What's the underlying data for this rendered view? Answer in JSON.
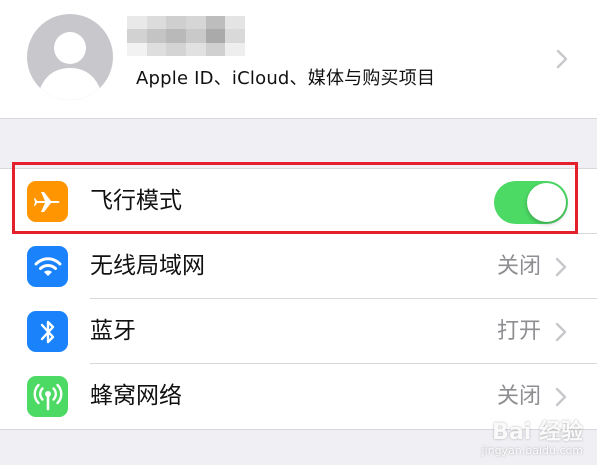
{
  "profile": {
    "subtitle": "Apple ID、iCloud、媒体与购买项目",
    "avatar_icon": "person-silhouette-icon",
    "chevron_icon": "chevron-right-icon"
  },
  "settings": {
    "airplane": {
      "label": "飞行模式",
      "icon": "airplane-icon",
      "color": "#ff9500",
      "toggle_on": true
    },
    "wifi": {
      "label": "无线局域网",
      "value": "关闭",
      "icon": "wifi-icon",
      "color": "#1a82fb"
    },
    "bluetooth": {
      "label": "蓝牙",
      "value": "打开",
      "icon": "bluetooth-icon",
      "color": "#1a82fb"
    },
    "cellular": {
      "label": "蜂窝网络",
      "value": "关闭",
      "icon": "cellular-antenna-icon",
      "color": "#4cd964"
    }
  },
  "annotation": {
    "highlight_color": "#e4202c"
  },
  "watermark": {
    "brand": "Bai 经验",
    "url": "jingyan.baidu.com"
  }
}
